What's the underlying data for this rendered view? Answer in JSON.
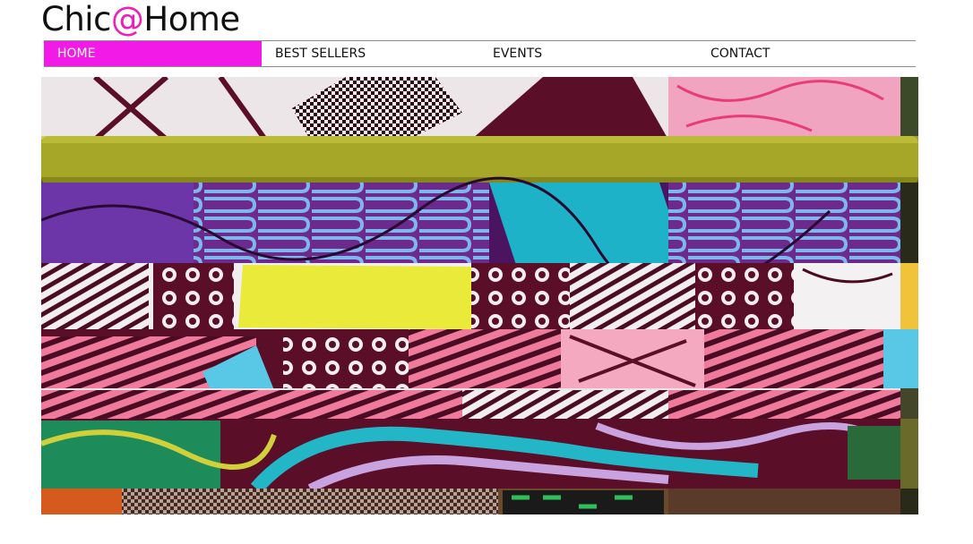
{
  "brand": {
    "logo_prefix": "Chic",
    "logo_at": "@",
    "logo_suffix": "Home",
    "accent_color": "#f21ae6"
  },
  "nav": {
    "items": [
      {
        "label": "HOME",
        "active": true
      },
      {
        "label": "BEST SELLERS",
        "active": false
      },
      {
        "label": "EVENTS",
        "active": false
      },
      {
        "label": "CONTACT",
        "active": false
      }
    ]
  },
  "hero": {
    "image_description": "stacked-african-wax-print-fabrics"
  }
}
